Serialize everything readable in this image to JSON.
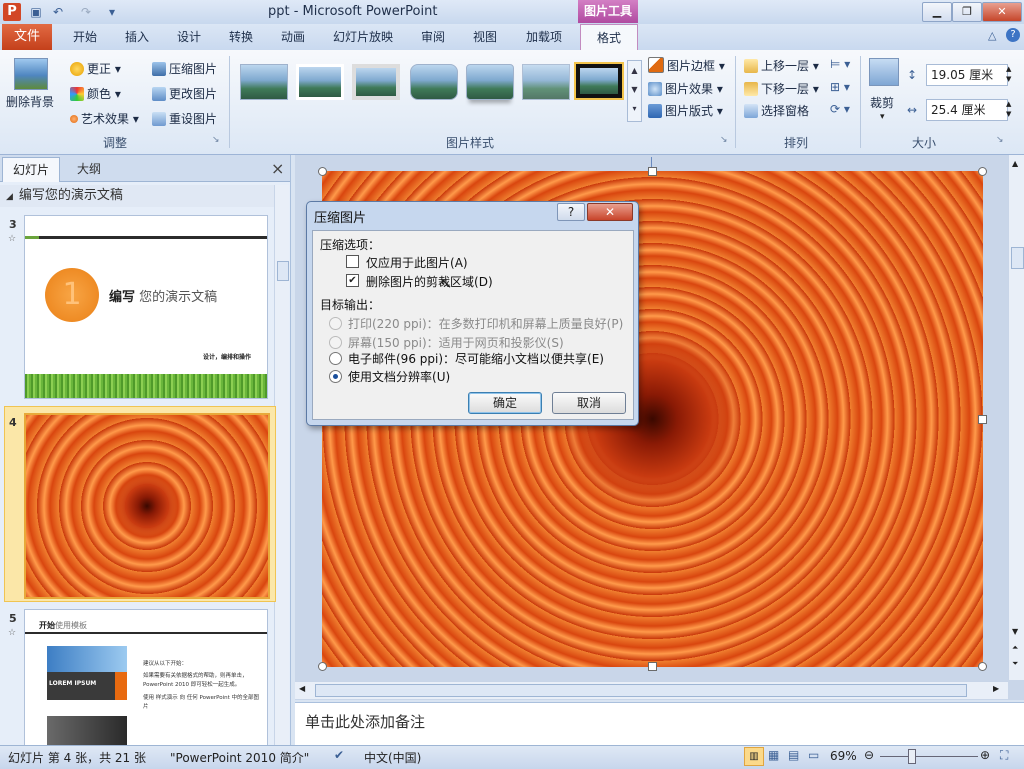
{
  "window": {
    "title": "ppt - Microsoft PowerPoint",
    "context_tab": "图片工具",
    "app_icon": "P",
    "quick_access": [
      "save-icon",
      "undo-icon",
      "redo-icon",
      "customize-icon"
    ]
  },
  "tabs": [
    "文件",
    "开始",
    "插入",
    "设计",
    "转换",
    "动画",
    "幻灯片放映",
    "审阅",
    "视图",
    "加载项",
    "格式"
  ],
  "ribbon": {
    "adjust": {
      "remove_bg": "删除背景",
      "correct": "更正",
      "color": "颜色",
      "artistic": "艺术效果",
      "compress": "压缩图片",
      "change": "更改图片",
      "reset": "重设图片",
      "label": "调整"
    },
    "styles": {
      "label": "图片样式"
    },
    "picture_opts": {
      "border": "图片边框",
      "effects": "图片效果",
      "layout": "图片版式"
    },
    "arrange": {
      "forward": "上移一层",
      "backward": "下移一层",
      "pane": "选择窗格",
      "label": "排列"
    },
    "size": {
      "crop": "裁剪",
      "height": "19.05 厘米",
      "width": "25.4 厘米",
      "label": "大小"
    }
  },
  "left_pane": {
    "tab_slides": "幻灯片",
    "tab_outline": "大纲",
    "close": "×",
    "section": "编写您的演示文稿",
    "slides": [
      {
        "num": "3",
        "title_bold": "编写",
        "title_rest": "您的演示文稿",
        "footer": "设计，编排和操作",
        "circle": "1"
      },
      {
        "num": "4"
      },
      {
        "num": "5",
        "title_bold": "开始",
        "title_rest": "使用模板",
        "label": "LOREM IPSUM",
        "text1": "建议从以下开始：",
        "text2": "如果需要有关依据格式的帮助，则再单击，PowerPoint 2010 即可轻松一起生成。",
        "text3": "使用 样式演示 向 任何 PowerPoint 中的全部图片"
      }
    ]
  },
  "notes_placeholder": "单击此处添加备注",
  "status": {
    "slide_info": "幻灯片 第 4 张，共 21 张",
    "theme": "\"PowerPoint 2010 简介\"",
    "language": "中文(中国)",
    "zoom": "69%"
  },
  "dialog": {
    "title": "压缩图片",
    "help": "?",
    "close": "✕",
    "compress_options": "压缩选项：",
    "opt_apply_only": "仅应用于此图片",
    "opt_apply_only_key": "(A)",
    "opt_delete_crop": "删除图片的剪裁区域",
    "opt_delete_crop_key": "(D)",
    "target_output": "目标输出：",
    "out_print": "打印(220 ppi)：在多数打印机和屏幕上质量良好",
    "out_print_key": "(P)",
    "out_screen": "屏幕(150 ppi)：适用于网页和投影仪",
    "out_screen_key": "(S)",
    "out_email": "电子邮件(96 ppi)：尽可能缩小文档以便共享",
    "out_email_key": "(E)",
    "out_document": "使用文档分辨率",
    "out_document_key": "(U)",
    "ok": "确定",
    "cancel": "取消",
    "state": {
      "apply_only_checked": false,
      "delete_crop_checked": true,
      "selected_output": "document"
    }
  }
}
